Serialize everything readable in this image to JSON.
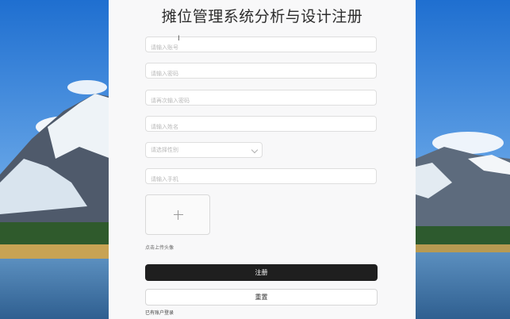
{
  "form": {
    "title": "摊位管理系统分析与设计注册",
    "account_placeholder": "请输入账号",
    "password_placeholder": "请输入密码",
    "confirm_password_placeholder": "请再次输入密码",
    "name_placeholder": "请输入姓名",
    "gender_placeholder": "请选择性别",
    "phone_placeholder": "请输入手机",
    "upload_label": "点击上传头像",
    "register_button": "注册",
    "reset_button": "重置",
    "login_link": "已有账户登录"
  },
  "icons": {
    "upload": "plus-icon",
    "select": "chevron-down-icon"
  },
  "colors": {
    "primary_button": "#1f1f1f",
    "panel": "#f8f8f9"
  }
}
